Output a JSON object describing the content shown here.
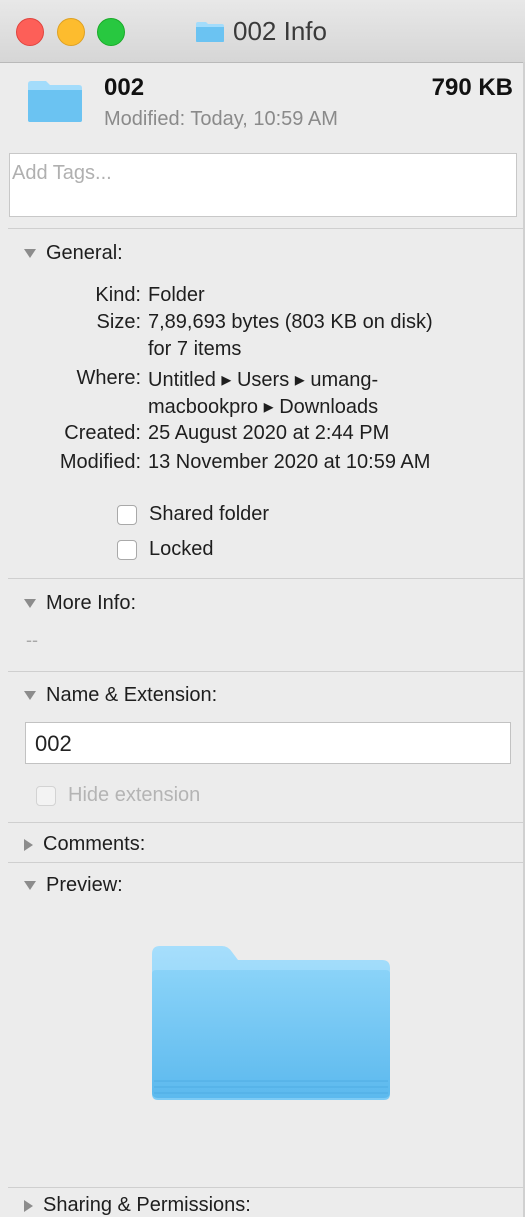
{
  "window": {
    "title": "002 Info"
  },
  "colors": {
    "folder_blue": "#6bc3f2",
    "folder_light": "#a3dcfb",
    "close": "#fd5f58",
    "minimize": "#fdbc2e",
    "zoom": "#28c840"
  },
  "header": {
    "name": "002",
    "size": "790 KB",
    "modified": "Modified: Today, 10:59 AM"
  },
  "tags": {
    "placeholder": "Add Tags..."
  },
  "general": {
    "title": "General:",
    "kind_label": "Kind:",
    "kind": "Folder",
    "size_label": "Size:",
    "size_line1": "7,89,693 bytes (803 KB on disk)",
    "size_line2": "for 7 items",
    "where_label": "Where:",
    "where_line1": "Untitled ▸ Users ▸ umang-",
    "where_line2": "macbookpro ▸ Downloads",
    "created_label": "Created:",
    "created": "25 August 2020 at 2:44 PM",
    "modified_label": "Modified:",
    "modified": "13 November 2020 at 10:59 AM",
    "shared_label": "Shared folder",
    "locked_label": "Locked"
  },
  "more_info": {
    "title": "More Info:",
    "value": "--"
  },
  "name_ext": {
    "title": "Name & Extension:",
    "value": "002",
    "hide_ext_label": "Hide extension"
  },
  "comments": {
    "title": "Comments:"
  },
  "preview": {
    "title": "Preview:"
  },
  "sharing": {
    "title": "Sharing & Permissions:"
  }
}
